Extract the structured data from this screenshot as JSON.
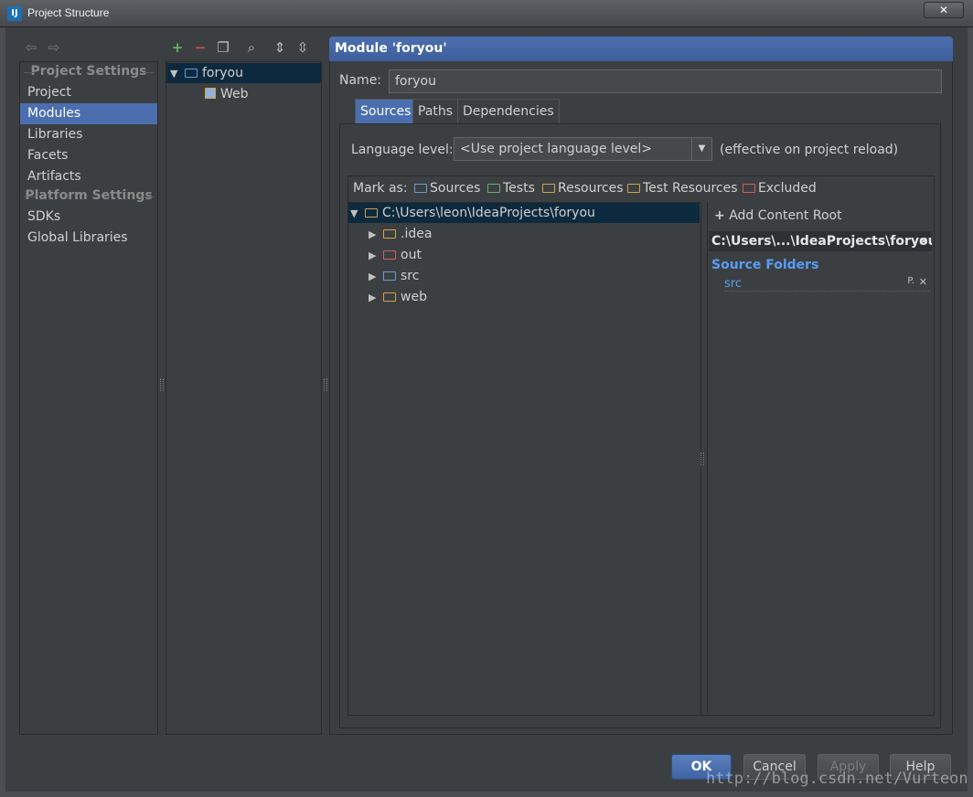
{
  "window": {
    "title": "Project Structure",
    "app_icon": "IJ",
    "close_label": "✕"
  },
  "colors": {
    "accent": "#4b6eaf",
    "selection_dark": "#0d293e",
    "sources": "#6b9bd2",
    "tests": "#6aab73",
    "resources": "#d0a44c",
    "excluded": "#d06060",
    "link": "#589df6"
  },
  "nav": {
    "back_icon": "arrow-left-icon",
    "forward_icon": "arrow-right-icon",
    "project_settings": "Project Settings",
    "items_top": [
      "Project",
      "Modules",
      "Libraries",
      "Facets",
      "Artifacts"
    ],
    "platform_settings": "Platform Settings",
    "items_bottom": [
      "SDKs",
      "Global Libraries"
    ]
  },
  "module_toolbar": [
    "plus-icon",
    "minus-icon",
    "copy-icon",
    "search-icon",
    "expand-all-icon",
    "collapse-all-icon"
  ],
  "module_tree": {
    "root": "foryou",
    "child": "Web"
  },
  "header": {
    "title": "Module 'foryou'"
  },
  "name_field": {
    "label": "Name:",
    "value": "foryou"
  },
  "tabs": [
    "Sources",
    "Paths",
    "Dependencies"
  ],
  "language": {
    "label": "Language level:",
    "value": "<Use project language level>",
    "note": "(effective on project reload)"
  },
  "mark_as": {
    "label": "Mark as:",
    "items": [
      "Sources",
      "Tests",
      "Resources",
      "Test Resources",
      "Excluded"
    ]
  },
  "content_tree": {
    "root": "C:\\Users\\leon\\IdeaProjects\\foryou",
    "children": [
      ".idea",
      "out",
      "src",
      "web"
    ]
  },
  "content_root": {
    "add_label": "Add Content Root",
    "path": "C:\\Users\\...\\IdeaProjects\\foryou",
    "source_folders_title": "Source Folders",
    "source_folder": "src"
  },
  "buttons": {
    "ok": "OK",
    "cancel": "Cancel",
    "apply": "Apply",
    "help": "Help"
  },
  "watermark": "http://blog.csdn.net/Vurteon"
}
